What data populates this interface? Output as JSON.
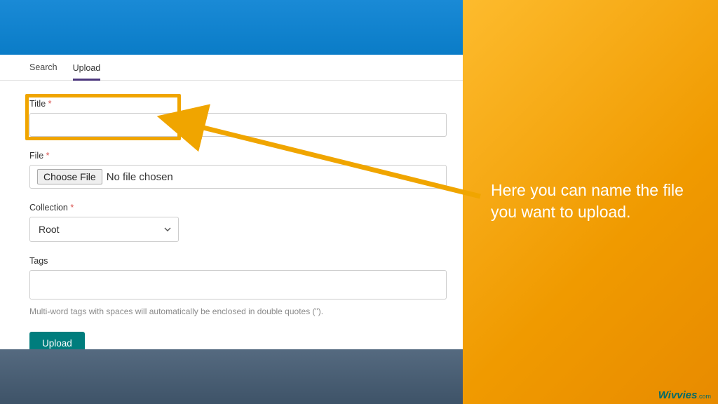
{
  "tabs": {
    "search": "Search",
    "upload": "Upload"
  },
  "form": {
    "title_label": "Title",
    "file_label": "File",
    "choose_file": "Choose File",
    "file_status": "No file chosen",
    "collection_label": "Collection",
    "collection_value": "Root",
    "tags_label": "Tags",
    "tags_help": "Multi-word tags with spaces will automatically be enclosed in double quotes (\").",
    "submit": "Upload"
  },
  "annotation": {
    "text": "Here you can name the file you want to upload."
  },
  "brand": {
    "name": "Wivvies",
    "suffix": ".com"
  },
  "required_marker": "*"
}
